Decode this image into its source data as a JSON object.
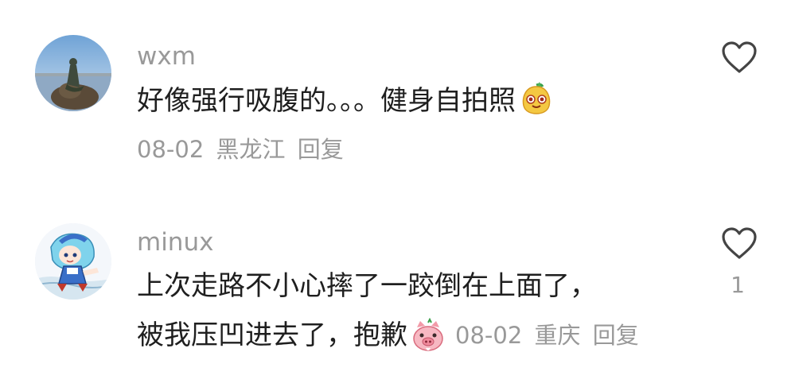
{
  "comments": [
    {
      "username": "wxm",
      "text_line1": "好像强行吸腹的。。。健身自拍照",
      "date": "08-02",
      "location": "黑龙江",
      "reply_label": "回复",
      "emoji": "yellow-fruit-emoji",
      "like_icon": "heart-outline-icon",
      "like_count": ""
    },
    {
      "username": "minux",
      "text_line1": "上次走路不小心摔了一跤倒在上面了，",
      "text_line2": "被我压凹进去了，抱歉",
      "date": "08-02",
      "location": "重庆",
      "reply_label": "回复",
      "emoji": "pig-emoji",
      "like_icon": "heart-outline-icon",
      "like_count": "1"
    }
  ],
  "colors": {
    "text": "#1f1f1f",
    "secondary": "#999999",
    "background": "#ffffff"
  }
}
